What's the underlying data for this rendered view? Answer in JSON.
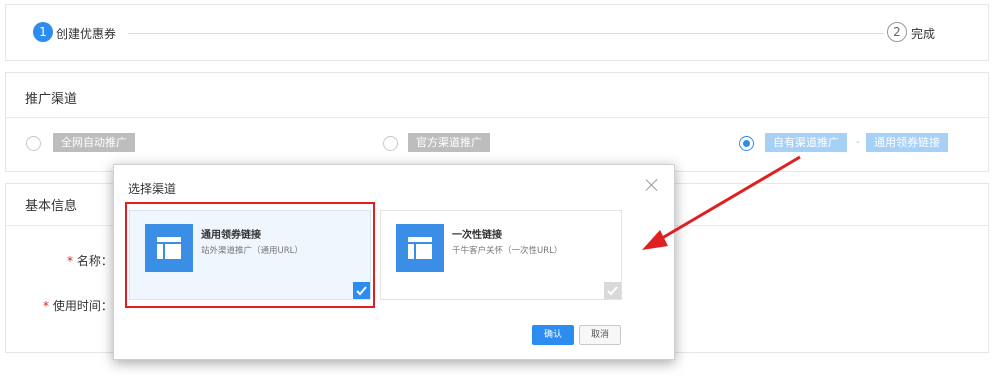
{
  "steps": {
    "step1": {
      "number": "1",
      "label": "创建优惠券"
    },
    "step2": {
      "number": "2",
      "label": "完成"
    }
  },
  "channel_section": {
    "title": "推广渠道",
    "options": [
      {
        "label": "全网自动推广",
        "selected": false
      },
      {
        "label": "官方渠道推广",
        "selected": false
      },
      {
        "label": "自有渠道推广",
        "selected": true,
        "sub_label": "通用领券链接"
      }
    ],
    "separator": "-"
  },
  "basic_section": {
    "title": "基本信息",
    "fields": [
      {
        "required_mark": "*",
        "label": "名称："
      },
      {
        "required_mark": "*",
        "label": "使用时间："
      }
    ]
  },
  "modal": {
    "title": "选择渠道",
    "close_icon": "close-icon",
    "cards": [
      {
        "name": "通用领券链接",
        "desc": "站外渠道推广（通用URL）",
        "icon": "layout-icon",
        "selected": true
      },
      {
        "name": "一次性链接",
        "desc": "千牛客户关怀（一次性URL）",
        "icon": "layout-icon",
        "selected": false
      }
    ],
    "confirm_label": "确认",
    "cancel_label": "取消"
  },
  "colors": {
    "accent": "#2d8cf0",
    "highlight": "#e02020",
    "tag_gray": "#bdbdbd",
    "tag_blue": "#a7d0f7"
  }
}
